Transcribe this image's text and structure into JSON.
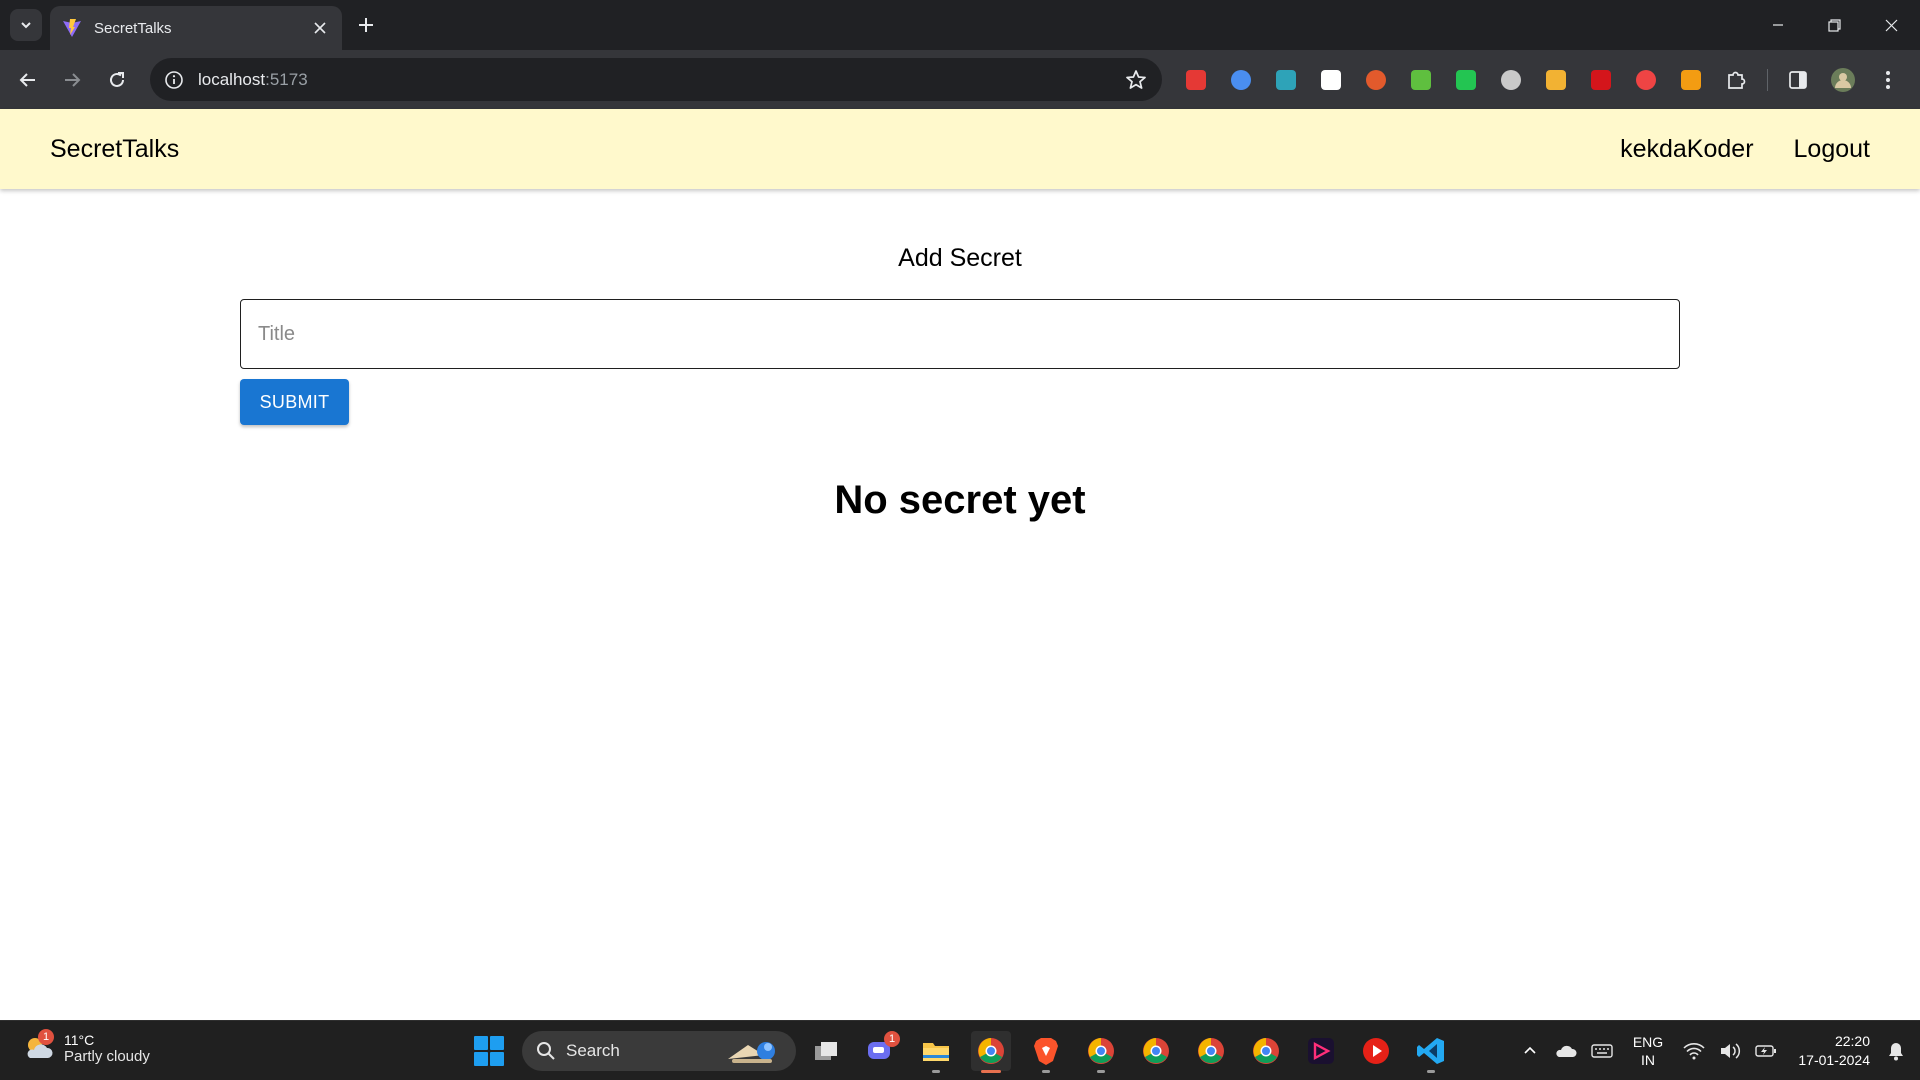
{
  "browser": {
    "tab": {
      "title": "SecretTalks",
      "favicon": "vite-favicon-icon",
      "close_icon": "close-icon"
    },
    "new_tab_icon": "plus-icon",
    "url": {
      "host": "localhost",
      "port": ":5173"
    },
    "extensions": [
      {
        "name": "red-extension-icon",
        "color": "#e53935"
      },
      {
        "name": "chart-extension-icon",
        "color": "#4a8ef0"
      },
      {
        "name": "calculator-extension-icon",
        "color": "#2ea3b8"
      },
      {
        "name": "omega-extension-icon",
        "color": "#ffffff"
      },
      {
        "name": "rocket-extension-icon",
        "color": "#e25a2c"
      },
      {
        "name": "green-plus-extension-icon",
        "color": "#5fbf3f"
      },
      {
        "name": "unlock-extension-icon",
        "color": "#23c552"
      },
      {
        "name": "incognito-extension-icon",
        "color": "#c9c9c9"
      },
      {
        "name": "brush-extension-icon",
        "color": "#f2b233"
      },
      {
        "name": "pdf-extension-icon",
        "color": "#d4151b"
      },
      {
        "name": "red-badge-extension-icon",
        "color": "#ef4444"
      },
      {
        "name": "orange-extension-icon",
        "color": "#f39c12"
      }
    ]
  },
  "app": {
    "brand": "SecretTalks",
    "username": "kekdaKoder",
    "logout_label": "Logout",
    "add_heading": "Add Secret",
    "title_placeholder": "Title",
    "submit_label": "SUBMIT",
    "empty_message": "No secret yet",
    "colors": {
      "navbar": "#fff9cc",
      "primary": "#1976d2"
    }
  },
  "taskbar": {
    "weather": {
      "temp": "11°C",
      "desc": "Partly cloudy",
      "badge": "1"
    },
    "search_label": "Search",
    "chat_badge": "1",
    "lang": {
      "line1": "ENG",
      "line2": "IN"
    },
    "clock": {
      "time": "22:20",
      "date": "17-01-2024"
    }
  }
}
